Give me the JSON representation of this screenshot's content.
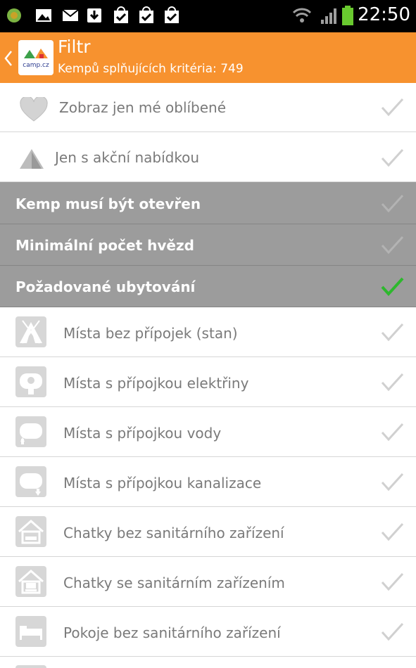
{
  "status_bar": {
    "time": "22:50",
    "left_icons": [
      "android-debug-icon",
      "image-icon",
      "mail-icon",
      "download-icon",
      "bag-check-icon",
      "bag-check-icon",
      "bag-check-icon"
    ],
    "right_icons": [
      "wifi-icon",
      "signal-icon",
      "battery-icon"
    ]
  },
  "action_bar": {
    "title": "Filtr",
    "subtitle": "Kempů splňujících kritéria: 749",
    "logo_text": "camp.cz",
    "color": "#f7922f"
  },
  "items_top": [
    {
      "label": "Zobraz jen mé oblíbené",
      "icon": "heart-icon",
      "checked": false
    },
    {
      "label": "Jen s akční nabídkou",
      "icon": "warning-triangle-icon",
      "checked": false
    }
  ],
  "sections": [
    {
      "label": "Kemp musí být otevřen",
      "checked": false
    },
    {
      "label": "Minimální počet hvězd",
      "checked": false
    },
    {
      "label": "Požadované ubytování",
      "checked": true
    }
  ],
  "accommodation_items": [
    {
      "label": "Místa bez přípojek (stan)",
      "icon": "tent-icon",
      "checked": false
    },
    {
      "label": "Místa s přípojkou elektřiny",
      "icon": "caravan-electric-icon",
      "checked": false
    },
    {
      "label": "Místa s přípojkou vody",
      "icon": "caravan-water-icon",
      "checked": false
    },
    {
      "label": "Místa s přípojkou kanalizace",
      "icon": "caravan-sewer-icon",
      "checked": false
    },
    {
      "label": "Chatky bez sanitárního zařízení",
      "icon": "cabin-icon",
      "checked": false
    },
    {
      "label": "Chatky se sanitárním zařízením",
      "icon": "cabin-wc-icon",
      "checked": false
    },
    {
      "label": "Pokoje bez sanitárního zařízení",
      "icon": "room-bed-icon",
      "checked": false
    }
  ],
  "colors": {
    "check_on": "#2db82d",
    "check_off": "#d0d0d0",
    "section_bg": "#9c9c9c"
  }
}
